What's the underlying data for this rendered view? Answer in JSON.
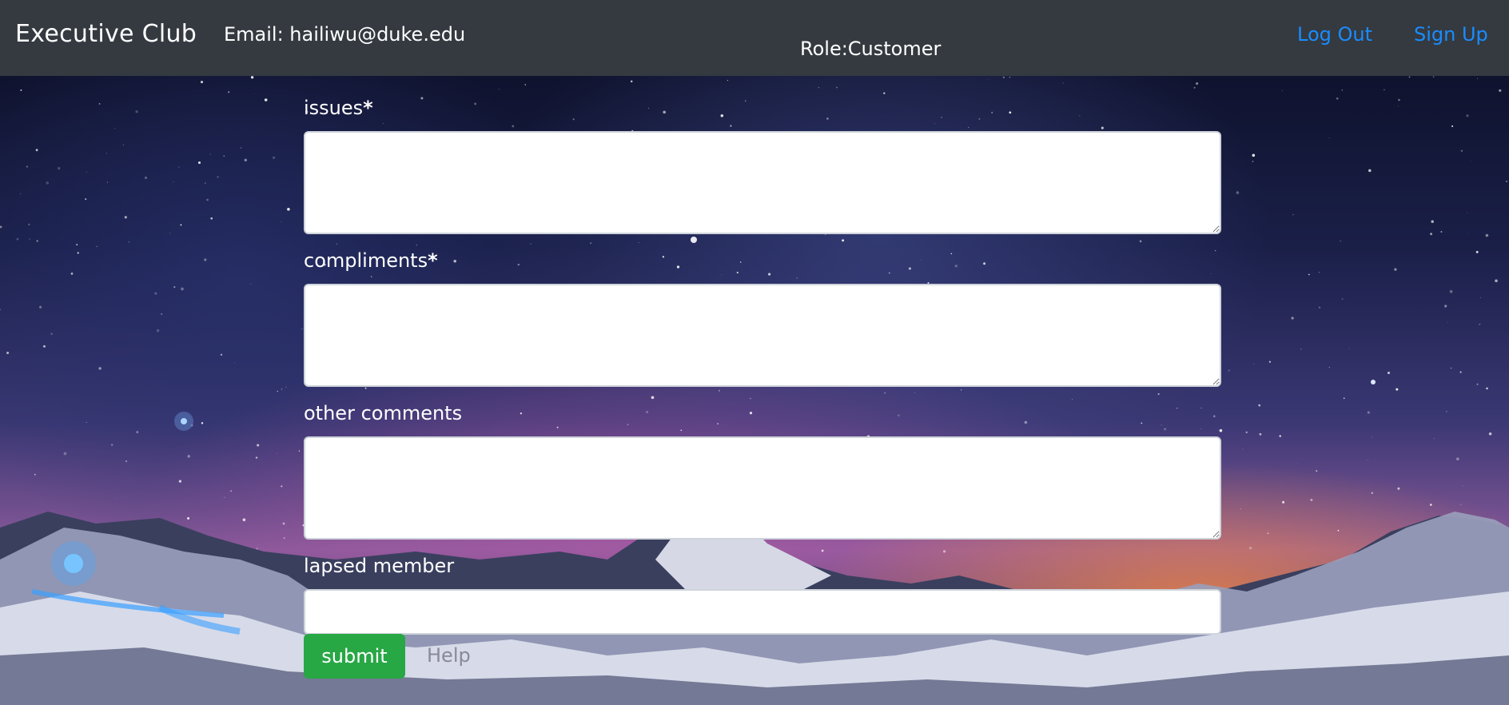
{
  "navbar": {
    "brand": "Executive Club",
    "email": "Email: hailiwu@duke.edu",
    "role": "Role:Customer",
    "logout_label": "Log Out",
    "signup_label": "Sign Up",
    "link_color": "#1a8cff",
    "background": "#343a40"
  },
  "form": {
    "issues": {
      "label": "issues",
      "required_mark": "*",
      "value": ""
    },
    "compliments": {
      "label": "compliments",
      "required_mark": "*",
      "value": ""
    },
    "other_comments": {
      "label": "other comments",
      "value": ""
    },
    "lapsed_member": {
      "label": "lapsed member",
      "value": ""
    },
    "submit_label": "submit",
    "submit_color": "#28a745",
    "help_label": "Help"
  }
}
